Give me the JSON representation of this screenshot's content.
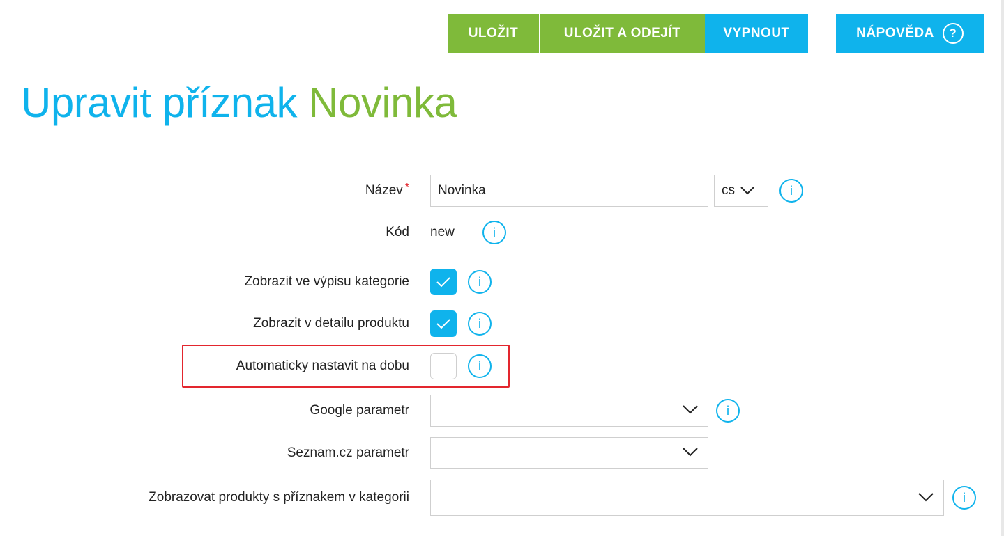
{
  "toolbar": {
    "save_label": "ULOŽIT",
    "save_exit_label": "ULOŽIT A ODEJÍT",
    "disable_label": "VYPNOUT",
    "help_label": "NÁPOVĚDA",
    "help_icon_glyph": "?"
  },
  "title": {
    "prefix": "Upravit příznak",
    "name": "Novinka"
  },
  "form": {
    "name": {
      "label": "Název",
      "required_mark": "*",
      "value": "Novinka",
      "lang": "cs"
    },
    "code": {
      "label": "Kód",
      "value": "new"
    },
    "show_in_category": {
      "label": "Zobrazit ve výpisu kategorie",
      "checked": true
    },
    "show_in_detail": {
      "label": "Zobrazit v detailu produktu",
      "checked": true
    },
    "auto_set_period": {
      "label": "Automaticky nastavit na dobu",
      "checked": false
    },
    "google_param": {
      "label": "Google parametr",
      "value": ""
    },
    "seznam_param": {
      "label": "Seznam.cz parametr",
      "value": ""
    },
    "show_products_in_category": {
      "label": "Zobrazovat produkty s příznakem v kategorii",
      "value": ""
    }
  },
  "icons": {
    "info": "info-icon",
    "check": "check-icon",
    "chevron": "chevron-down-icon",
    "help": "help-icon"
  },
  "colors": {
    "green": "#7fba3a",
    "blue": "#0fb3ec",
    "required": "#e3262e",
    "highlight": "#e3262e"
  }
}
